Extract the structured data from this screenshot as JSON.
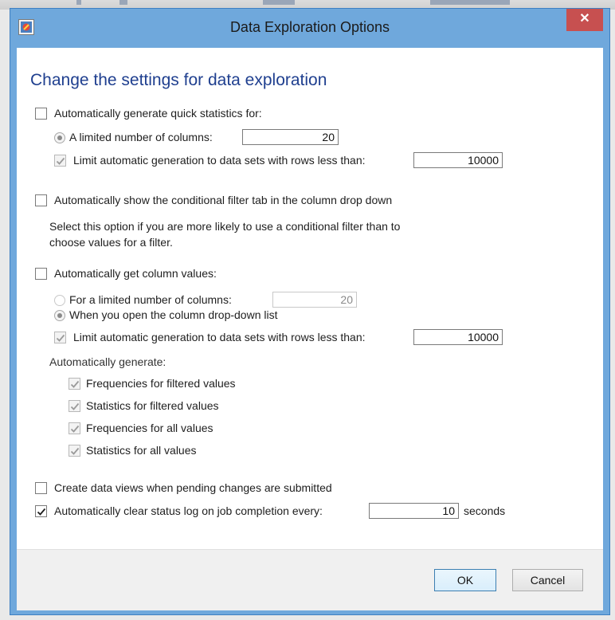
{
  "window": {
    "title": "Data Exploration Options",
    "close_label": "✕"
  },
  "heading": "Change the settings for data exploration",
  "quick_stats": {
    "label": "Automatically generate quick statistics for:",
    "checked": false,
    "limited_columns_label": "A limited number of columns:",
    "limited_columns_value": "20",
    "limited_columns_selected": true,
    "limit_rows_label": "Limit automatic generation to data sets with rows less than:",
    "limit_rows_value": "10000",
    "limit_rows_checked": true
  },
  "conditional_filter": {
    "label": "Automatically show the conditional filter tab in the column drop down",
    "checked": false,
    "description_line1": "Select this option if you are more likely to use a conditional filter than to",
    "description_line2": "choose values for a filter."
  },
  "column_values": {
    "label": "Automatically get column values:",
    "checked": false,
    "limited_columns_label": "For a limited number of columns:",
    "limited_columns_value": "20",
    "limited_columns_selected": false,
    "open_dropdown_label": "When you open the column drop-down list",
    "open_dropdown_selected": true,
    "limit_rows_label": "Limit automatic generation to data sets with rows less than:",
    "limit_rows_value": "10000",
    "limit_rows_checked": true,
    "generate_label": "Automatically generate:",
    "generate_options": [
      {
        "label": "Frequencies for filtered values",
        "checked": true
      },
      {
        "label": "Statistics for filtered values",
        "checked": true
      },
      {
        "label": "Frequencies for all values",
        "checked": true
      },
      {
        "label": "Statistics for all values",
        "checked": true
      }
    ]
  },
  "create_views": {
    "label": "Create data views when pending changes are submitted",
    "checked": false
  },
  "clear_log": {
    "label": "Automatically clear status log on job completion every:",
    "checked": true,
    "value": "10",
    "unit": "seconds"
  },
  "buttons": {
    "ok": "OK",
    "cancel": "Cancel"
  },
  "colors": {
    "title_bar": "#6fa8dc",
    "close_button": "#c75050",
    "heading": "#1f3f8f"
  }
}
